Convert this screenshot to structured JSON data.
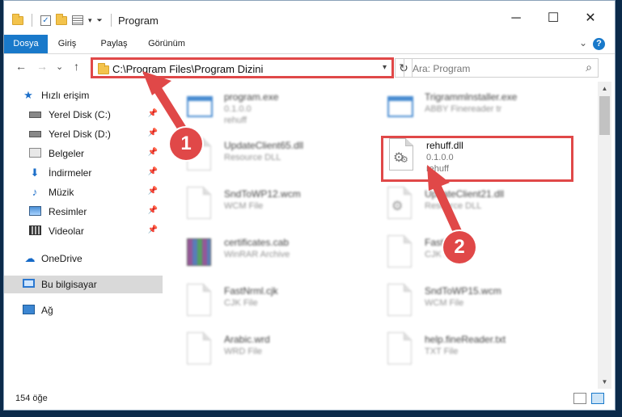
{
  "window": {
    "title": "Program",
    "minimize": "─",
    "maximize": "☐",
    "close": "✕"
  },
  "ribbon": {
    "tabs": [
      {
        "label": "Dosya",
        "active": true
      },
      {
        "label": "Giriş",
        "active": false
      },
      {
        "label": "Paylaş",
        "active": false
      },
      {
        "label": "Görünüm",
        "active": false
      }
    ],
    "help": "?"
  },
  "nav": {
    "back": "←",
    "forward": "→",
    "recent": "⌄",
    "up": "↑",
    "address": "C:\\Program Files\\Program Dizini",
    "refresh": "↻",
    "search_placeholder": "Ara: Program"
  },
  "sidebar": {
    "items": [
      {
        "label": "Hızlı erişim",
        "icon": "star-icon"
      },
      {
        "label": "Yerel Disk (C:)",
        "icon": "drive-icon",
        "pinned": true
      },
      {
        "label": "Yerel Disk (D:)",
        "icon": "drive-icon",
        "pinned": true
      },
      {
        "label": "Belgeler",
        "icon": "documents-icon",
        "pinned": true
      },
      {
        "label": "İndirmeler",
        "icon": "download-icon",
        "pinned": true
      },
      {
        "label": "Müzik",
        "icon": "music-icon",
        "pinned": true
      },
      {
        "label": "Resimler",
        "icon": "pictures-icon",
        "pinned": true
      },
      {
        "label": "Videolar",
        "icon": "videos-icon",
        "pinned": true
      },
      {
        "label": "OneDrive",
        "icon": "onedrive-icon"
      },
      {
        "label": "Bu bilgisayar",
        "icon": "this-pc-icon",
        "selected": true
      },
      {
        "label": "Ağ",
        "icon": "network-icon"
      }
    ]
  },
  "files": [
    {
      "name": "program.exe",
      "line1": "0.1.0.0",
      "line2": "rehuff",
      "icon": "exe-icon"
    },
    {
      "name": "Trigrammlnstaller.exe",
      "line1": "ABBY Finereader tr",
      "line2": "",
      "icon": "exe-icon"
    },
    {
      "name": "UpdateClient65.dll",
      "line1": "Resource DLL",
      "line2": "",
      "icon": "document-icon"
    },
    {
      "name": "rehuff.dll",
      "line1": "0.1.0.0",
      "line2": "rehuff",
      "icon": "dll-gear-icon",
      "highlighted": true
    },
    {
      "name": "SndToWP12.wcm",
      "line1": "WCM File",
      "line2": "",
      "icon": "document-icon"
    },
    {
      "name": "UpdateClient21.dll",
      "line1": "Resource DLL",
      "line2": "",
      "icon": "dll-gear-icon"
    },
    {
      "name": "certificates.cab",
      "line1": "WinRAR Archive",
      "line2": "",
      "icon": "winrar-icon"
    },
    {
      "name": "FastNml",
      "line1": "CJK File",
      "line2": "",
      "icon": "document-icon"
    },
    {
      "name": "FastNrml.cjk",
      "line1": "CJK File",
      "line2": "",
      "icon": "document-icon"
    },
    {
      "name": "SndToWP15.wcm",
      "line1": "WCM File",
      "line2": "",
      "icon": "document-icon"
    },
    {
      "name": "Arabic.wrd",
      "line1": "WRD File",
      "line2": "",
      "icon": "document-icon"
    },
    {
      "name": "help.fineReader.txt",
      "line1": "TXT File",
      "line2": "",
      "icon": "document-icon"
    }
  ],
  "status": {
    "count": "154 öğe"
  },
  "annotations": {
    "callout1": "1",
    "callout2": "2",
    "color": "#e04848"
  }
}
